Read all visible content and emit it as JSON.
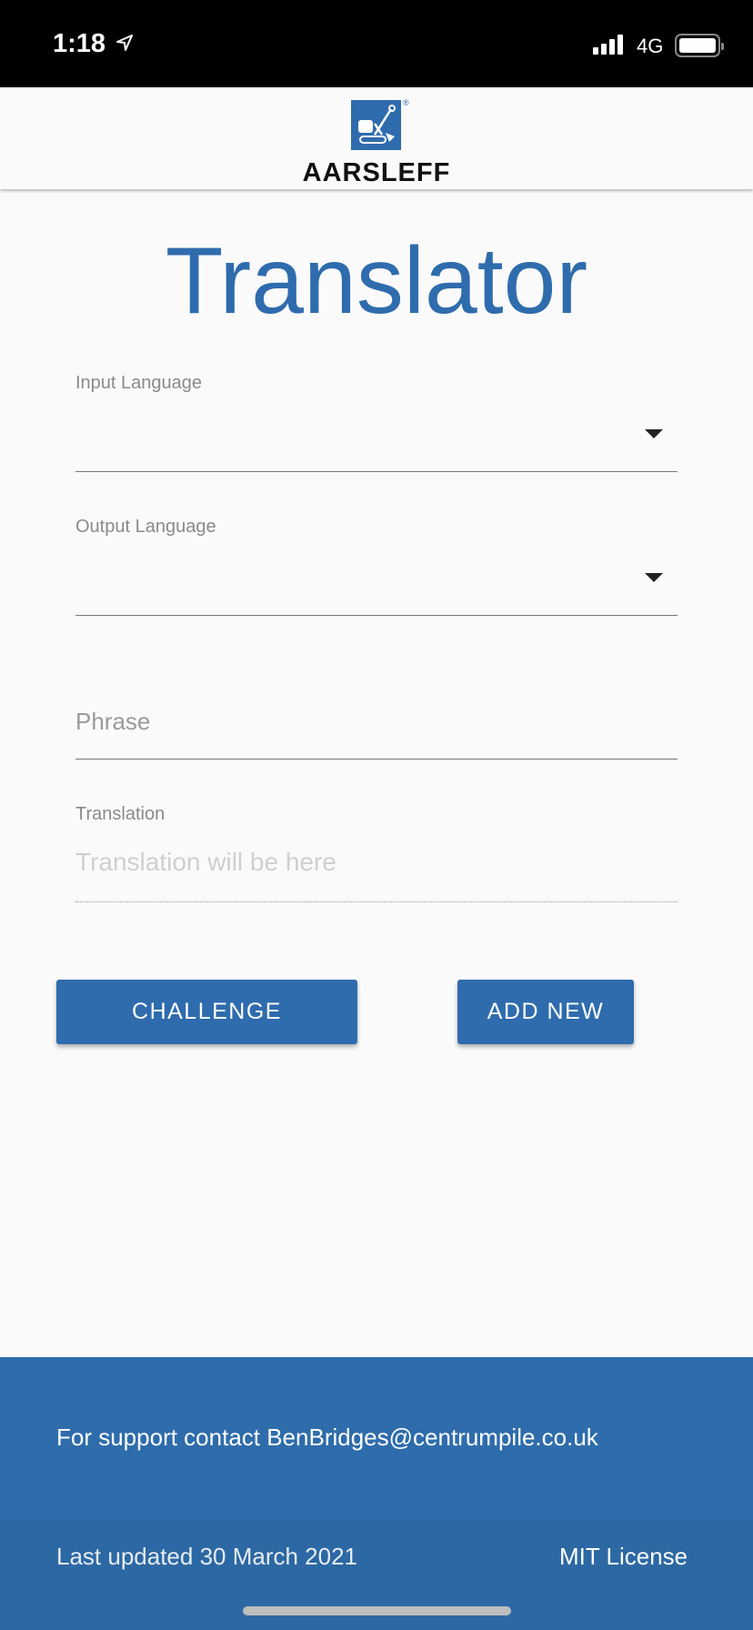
{
  "status_bar": {
    "time": "1:18",
    "network": "4G"
  },
  "header": {
    "logo_text": "AARSLEFF",
    "logo_mark": "®"
  },
  "page": {
    "title": "Translator"
  },
  "form": {
    "input_language": {
      "label": "Input Language",
      "value": ""
    },
    "output_language": {
      "label": "Output Language",
      "value": ""
    },
    "phrase": {
      "placeholder": "Phrase",
      "value": ""
    },
    "translation": {
      "label": "Translation",
      "placeholder": "Translation will be here"
    }
  },
  "buttons": {
    "challenge": "CHALLENGE",
    "add_new": "ADD NEW"
  },
  "footer": {
    "support": "For support contact BenBridges@centrumpile.co.uk",
    "updated": "Last updated 30 March 2021",
    "license": "MIT License"
  },
  "colors": {
    "primary": "#2f6cad"
  }
}
